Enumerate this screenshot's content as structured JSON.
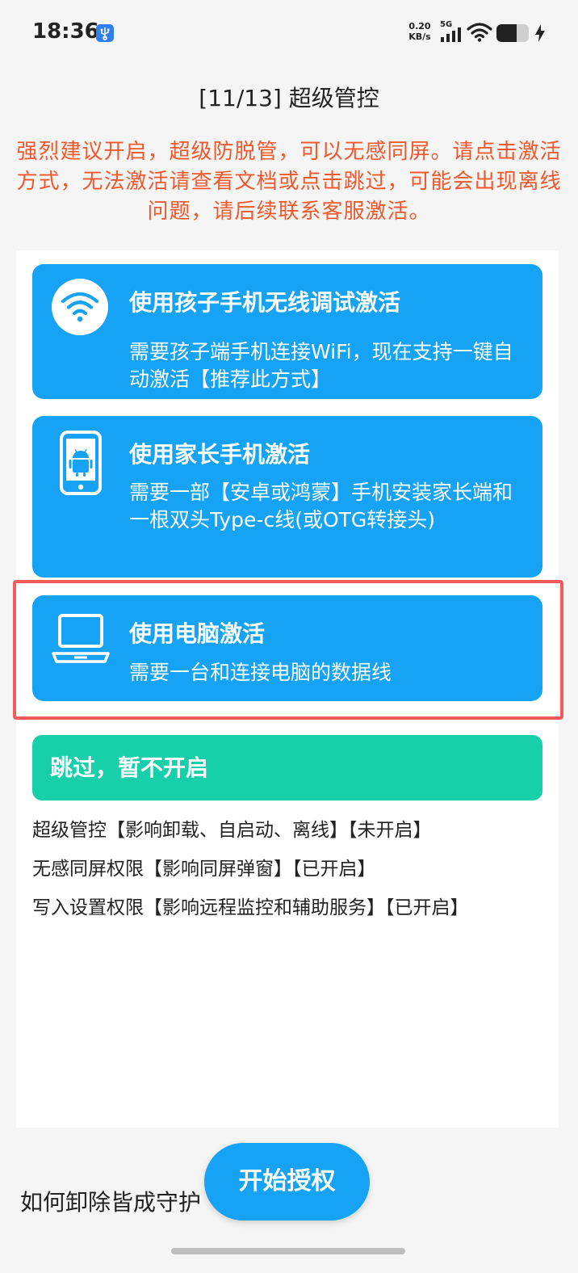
{
  "status_bar": {
    "time": "18:36",
    "net_speed_value": "0.20",
    "net_speed_unit": "KB/s",
    "signal_label": "5G",
    "icons": [
      "usb-icon",
      "signal-icon",
      "wifi-icon",
      "battery-icon",
      "charging-icon"
    ]
  },
  "header": {
    "title": "[11/13] 超级管控",
    "warning": "强烈建议开启，超级防脱管，可以无感同屏。请点击激活方式，无法激活请查看文档或点击跳过，可能会出现离线问题，请后续联系客服激活。"
  },
  "options": [
    {
      "icon": "wifi-icon",
      "title": "使用孩子手机无线调试激活",
      "desc": "需要孩子端手机连接WiFi，现在支持一键自动激活【推荐此方式】"
    },
    {
      "icon": "android-phone-icon",
      "title": "使用家长手机激活",
      "desc": "需要一部【安卓或鸿蒙】手机安装家长端和一根双头Type-c线(或OTG转接头)"
    },
    {
      "icon": "laptop-icon",
      "title": "使用电脑激活",
      "desc": "需要一台和连接电脑的数据线"
    }
  ],
  "skip_label": "跳过，暂不开启",
  "permissions": [
    "超级管控【影响卸载、自启动、离线】【未开启】",
    "无感同屏权限【影响同屏弹窗】【已开启】",
    "写入设置权限【影响远程监控和辅助服务】【已开启】"
  ],
  "footer": {
    "uninstall_link": "如何卸除皆成守护",
    "start_button": "开始授权"
  },
  "colors": {
    "accent_blue": "#16a3f6",
    "skip_green": "#17cfa8",
    "warning_orange": "#f2582c",
    "highlight_red": "#f45a5a"
  }
}
